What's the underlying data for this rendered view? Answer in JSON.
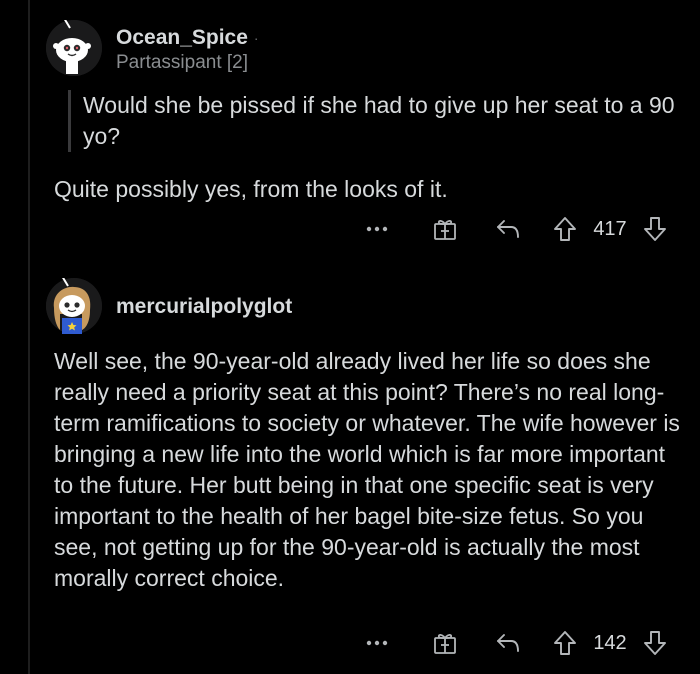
{
  "comments": [
    {
      "username": "Ocean_Spice",
      "separator": "·",
      "flair": "Partassipant [2]",
      "quote": "Would she be pissed if she had to give up her seat to a 90 yo?",
      "body": "Quite possibly yes, from the looks of it.",
      "votes": "417",
      "avatar": "snoo-avatar-icon"
    },
    {
      "username": "mercurialpolyglot",
      "body": "Well see, the 90-year-old already lived her life so does she really need a priority seat at this point? There’s no real long-term ramifications to society or whatever. The wife however is bringing a new life into the world which is far more important to the future. Her butt being in that one specific seat is very important to the health of her bagel bite-size fetus. So you see, not getting up for the 90-year-old is actually the most morally correct choice.",
      "votes": "142",
      "avatar": "snoo-avatar-icon"
    }
  ],
  "actions": {
    "more": "more-options-icon",
    "award": "award-icon",
    "reply": "reply-icon",
    "upvote": "upvote-icon",
    "downvote": "downvote-icon"
  },
  "colors": {
    "background": "#000000",
    "text": "#d7dadc",
    "muted": "#8a8d90",
    "icon": "#b3b6b9"
  }
}
